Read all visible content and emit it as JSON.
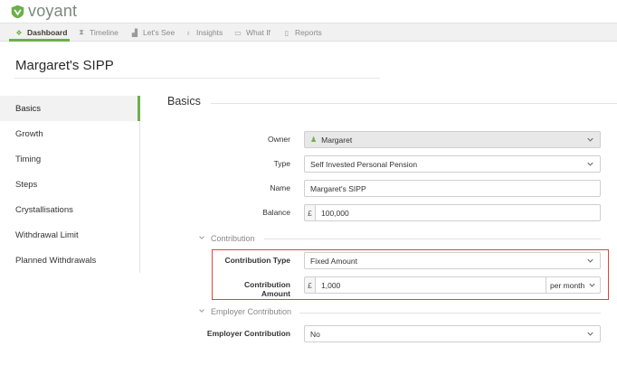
{
  "brand": {
    "name": "voyant",
    "color": "#6ab04c"
  },
  "nav": {
    "items": [
      {
        "label": "Dashboard",
        "icon": "dashboard-icon",
        "active": true
      },
      {
        "label": "Timeline",
        "icon": "hourglass-icon"
      },
      {
        "label": "Let's See",
        "icon": "bar-chart-icon"
      },
      {
        "label": "Insights",
        "icon": "lightbulb-icon"
      },
      {
        "label": "What If",
        "icon": "book-icon"
      },
      {
        "label": "Reports",
        "icon": "document-icon"
      }
    ]
  },
  "page": {
    "title": "Margaret's SIPP"
  },
  "sidebar": {
    "items": [
      {
        "label": "Basics",
        "active": true
      },
      {
        "label": "Growth"
      },
      {
        "label": "Timing"
      },
      {
        "label": "Steps"
      },
      {
        "label": "Crystallisations"
      },
      {
        "label": "Withdrawal Limit"
      },
      {
        "label": "Planned Withdrawals"
      }
    ]
  },
  "section": {
    "title": "Basics"
  },
  "form": {
    "owner": {
      "label": "Owner",
      "value": "Margaret"
    },
    "type": {
      "label": "Type",
      "value": "Self Invested Personal Pension"
    },
    "name": {
      "label": "Name",
      "value": "Margaret's SIPP"
    },
    "balance": {
      "label": "Balance",
      "prefix": "£",
      "value": "100,000"
    },
    "contribution_group": {
      "label": "Contribution"
    },
    "contribution_type": {
      "label": "Contribution Type",
      "value": "Fixed Amount"
    },
    "contribution_amount": {
      "label": "Contribution Amount",
      "prefix": "£",
      "value": "1,000",
      "period": "per month"
    },
    "employer_group": {
      "label": "Employer Contribution"
    },
    "employer_contribution": {
      "label": "Employer Contribution",
      "value": "No"
    }
  },
  "colors": {
    "accent": "#6ab04c",
    "highlight": "#e0433a"
  }
}
